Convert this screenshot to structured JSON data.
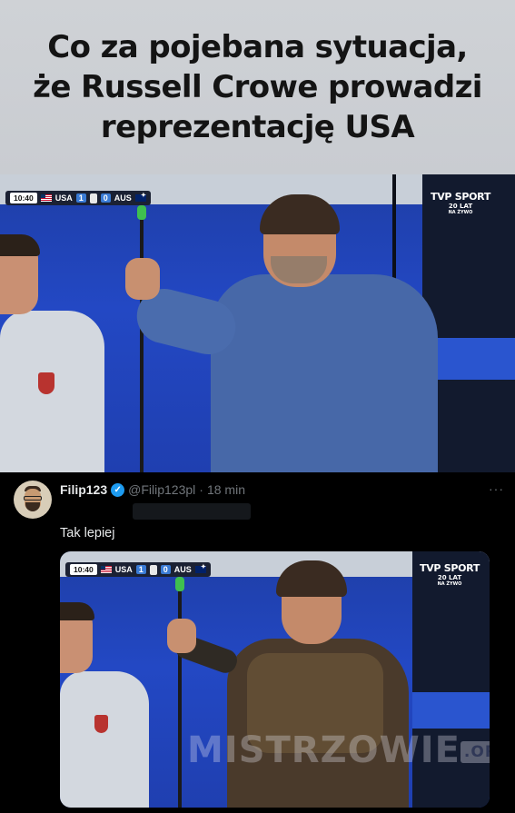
{
  "caption": {
    "line1": "Co za pojebana sytuacja,",
    "line2": "że Russell Crowe prowadzi",
    "line3": "reprezentację USA"
  },
  "broadcast": {
    "clock": "10:40",
    "home_team": "USA",
    "home_score": "1",
    "away_score": "0",
    "away_team": "AUS",
    "logo_line1": "TVP SPORT",
    "logo_line2": "LAT",
    "logo_line3": "NA ŻYWO",
    "logo_number": "20"
  },
  "tweet": {
    "author_name": "Filip123",
    "handle": "@Filip123pl",
    "separator": "·",
    "time": "18 min",
    "more": "···",
    "text": "Tak lepiej"
  },
  "watermark": {
    "text": "MISTRZOWIE",
    "suffix": ".ORG"
  },
  "colors": {
    "caption_bg": "#cbced3",
    "field_blue": "#2348c4",
    "tweet_bg": "#000000",
    "verified_blue": "#1d9bf0"
  }
}
